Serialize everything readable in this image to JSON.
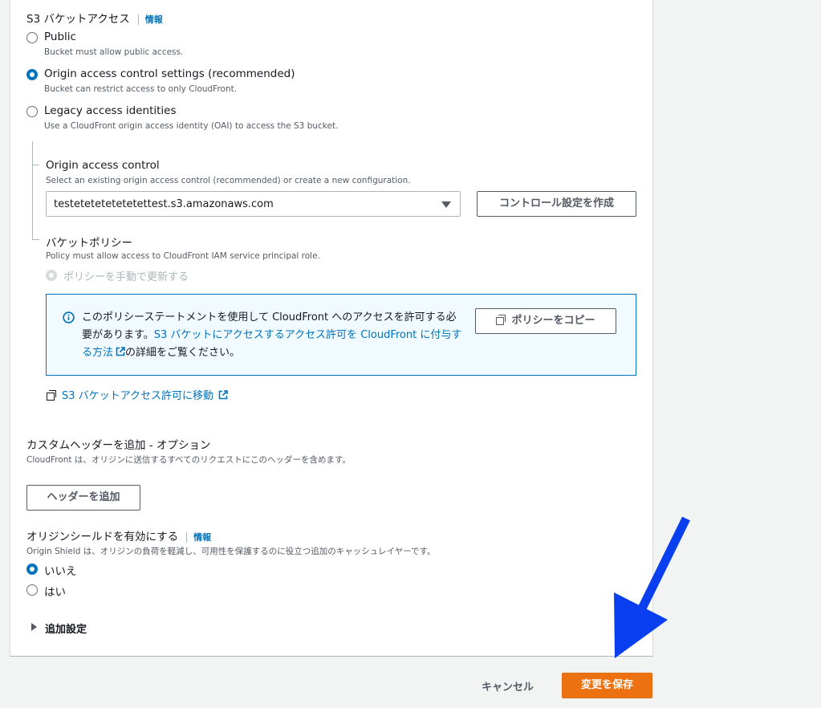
{
  "s3_access": {
    "title": "S3 バケットアクセス",
    "info": "情報",
    "options": [
      {
        "label": "Public",
        "desc": "Bucket must allow public access.",
        "checked": false
      },
      {
        "label": "Origin access control settings (recommended)",
        "desc": "Bucket can restrict access to only CloudFront.",
        "checked": true
      },
      {
        "label": "Legacy access identities",
        "desc": "Use a CloudFront origin access identity (OAI) to access the S3 bucket.",
        "checked": false
      }
    ]
  },
  "oac": {
    "title": "Origin access control",
    "desc": "Select an existing origin access control (recommended) or create a new configuration.",
    "selected": "testetetetetetetettest.s3.amazonaws.com",
    "create_button": "コントロール設定を作成"
  },
  "bucket_policy": {
    "title": "バケットポリシー",
    "desc": "Policy must allow access to CloudFront IAM service principal role.",
    "manual_option": "ポリシーを手動で更新する",
    "alert_text_1": "このポリシーステートメントを使用して CloudFront へのアクセスを許可する必要があります。",
    "alert_link": "S3 バケットにアクセスするアクセス許可を CloudFront に付与する方法",
    "alert_text_2": "の詳細をご覧ください。",
    "copy_button": "ポリシーをコピー",
    "goto_link": "S3 バケットアクセス許可に移動"
  },
  "custom_headers": {
    "title": "カスタムヘッダーを追加 - オプション",
    "desc": "CloudFront は、オリジンに送信するすべてのリクエストにこのヘッダーを含めます。",
    "add_button": "ヘッダーを追加"
  },
  "origin_shield": {
    "title": "オリジンシールドを有効にする",
    "info": "情報",
    "desc": "Origin Shield は、オリジンの負荷を軽減し、可用性を保護するのに役立つ追加のキャッシュレイヤーです。",
    "options": [
      {
        "label": "いいえ",
        "checked": true
      },
      {
        "label": "はい",
        "checked": false
      }
    ]
  },
  "additional_settings": "追加設定",
  "footer": {
    "cancel": "キャンセル",
    "save": "変更を保存"
  },
  "colors": {
    "primary": "#ec7211",
    "link": "#0073bb",
    "annotation_arrow": "#0a3ff0"
  }
}
